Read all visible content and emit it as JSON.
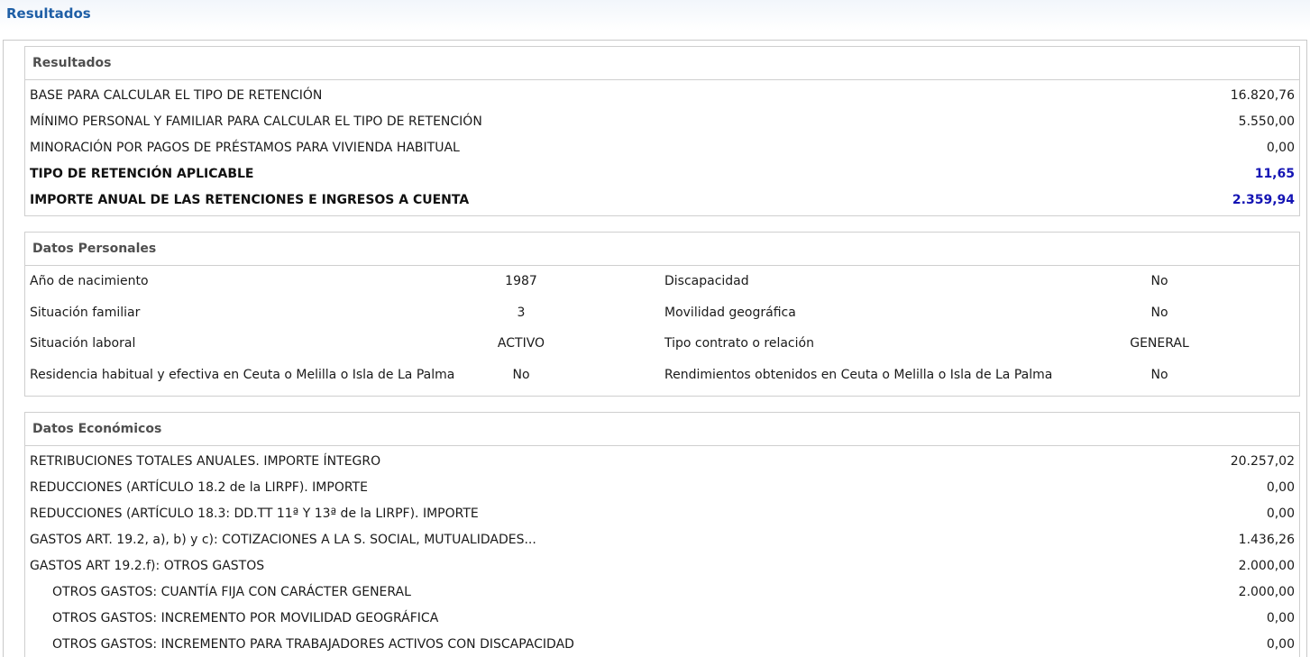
{
  "page": {
    "title": "Resultados"
  },
  "resultados": {
    "header": "Resultados",
    "rows": [
      {
        "label": "BASE PARA CALCULAR EL TIPO DE RETENCIÓN",
        "value": "16.820,76"
      },
      {
        "label": "MÍNIMO PERSONAL Y FAMILIAR PARA CALCULAR EL TIPO DE RETENCIÓN",
        "value": "5.550,00"
      },
      {
        "label": "MINORACIÓN POR PAGOS DE PRÉSTAMOS PARA VIVIENDA HABITUAL",
        "value": "0,00"
      },
      {
        "label": "TIPO DE RETENCIÓN APLICABLE",
        "value": "11,65"
      },
      {
        "label": "IMPORTE ANUAL DE LAS RETENCIONES E INGRESOS A CUENTA",
        "value": "2.359,94"
      }
    ]
  },
  "personales": {
    "header": "Datos Personales",
    "rows": [
      {
        "l1": "Año de nacimiento",
        "v1": "1987",
        "l2": "Discapacidad",
        "v2": "No"
      },
      {
        "l1": "Situación familiar",
        "v1": "3",
        "l2": "Movilidad geográfica",
        "v2": "No"
      },
      {
        "l1": "Situación laboral",
        "v1": "ACTIVO",
        "l2": "Tipo contrato o relación",
        "v2": "GENERAL"
      },
      {
        "l1": "Residencia habitual y efectiva en Ceuta o Melilla o Isla de La Palma",
        "v1": "No",
        "l2": "Rendimientos obtenidos en Ceuta o Melilla o Isla de La Palma",
        "v2": "No"
      }
    ]
  },
  "economicos": {
    "header": "Datos Económicos",
    "rows": [
      {
        "label": "RETRIBUCIONES TOTALES ANUALES. IMPORTE ÍNTEGRO",
        "value": "20.257,02"
      },
      {
        "label": "REDUCCIONES (ARTÍCULO 18.2 de la LIRPF). IMPORTE",
        "value": "0,00"
      },
      {
        "label": "REDUCCIONES (ARTÍCULO 18.3: DD.TT 11ª Y 13ª de la LIRPF). IMPORTE",
        "value": "0,00"
      },
      {
        "label": "GASTOS ART. 19.2, a), b) y c): COTIZACIONES A LA S. SOCIAL, MUTUALIDADES...",
        "value": "1.436,26"
      },
      {
        "label": "GASTOS ART 19.2.f): OTROS GASTOS",
        "value": "2.000,00"
      },
      {
        "label": "OTROS GASTOS: CUANTÍA FIJA CON CARÁCTER GENERAL",
        "value": "2.000,00"
      },
      {
        "label": "OTROS GASTOS: INCREMENTO POR MOVILIDAD GEOGRÁFICA",
        "value": "0,00"
      },
      {
        "label": "OTROS GASTOS: INCREMENTO PARA TRABAJADORES ACTIVOS CON DISCAPACIDAD",
        "value": "0,00"
      }
    ]
  }
}
